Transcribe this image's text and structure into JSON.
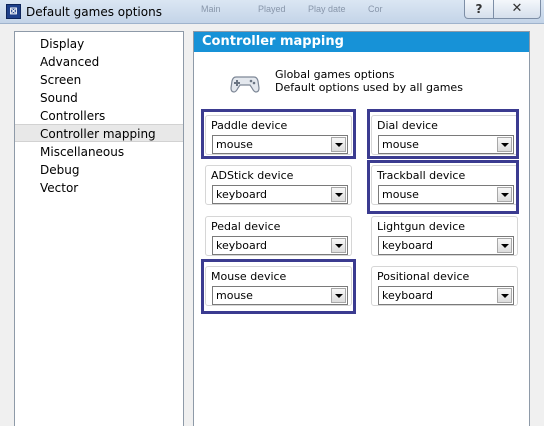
{
  "window": {
    "title": "Default games options",
    "help_label": "?",
    "close_label": "✕",
    "background_menu": [
      "Main",
      "Played",
      "Play date",
      "Cor"
    ]
  },
  "nav": {
    "items": [
      {
        "label": "Display"
      },
      {
        "label": "Advanced"
      },
      {
        "label": "Screen"
      },
      {
        "label": "Sound"
      },
      {
        "label": "Controllers"
      },
      {
        "label": "Controller mapping",
        "selected": true
      },
      {
        "label": "Miscellaneous"
      },
      {
        "label": "Debug"
      },
      {
        "label": "Vector"
      }
    ]
  },
  "panel": {
    "header": "Controller mapping",
    "global_title": "Global games options",
    "global_subtitle": "Default options used by all games",
    "devices": [
      {
        "label": "Paddle device",
        "value": "mouse",
        "highlighted": true
      },
      {
        "label": "Dial device",
        "value": "mouse",
        "highlighted": true
      },
      {
        "label": "ADStick device",
        "value": "keyboard",
        "highlighted": false
      },
      {
        "label": "Trackball device",
        "value": "mouse",
        "highlighted": true
      },
      {
        "label": "Pedal device",
        "value": "keyboard",
        "highlighted": false
      },
      {
        "label": "Lightgun device",
        "value": "keyboard",
        "highlighted": false
      },
      {
        "label": "Mouse device",
        "value": "mouse",
        "highlighted": true
      },
      {
        "label": "Positional device",
        "value": "keyboard",
        "highlighted": false
      }
    ]
  },
  "colors": {
    "header_bg": "#1792d7",
    "highlight_border": "#3b3b90"
  }
}
